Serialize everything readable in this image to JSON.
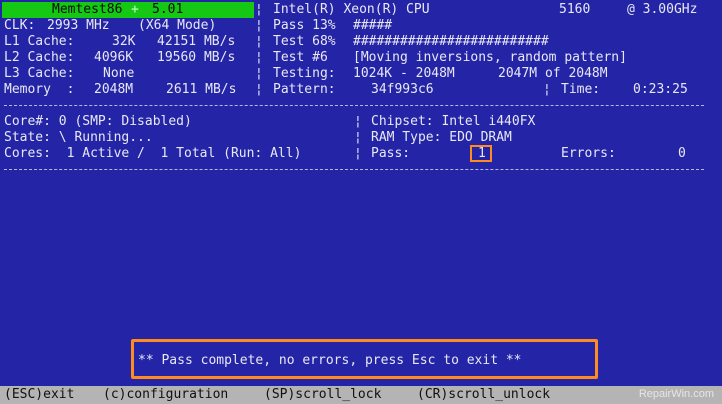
{
  "header": {
    "app_name": "Memtest86",
    "app_plus": "+",
    "version": "5.01",
    "cpu_name": "Intel(R) Xeon(R) CPU",
    "cpu_model": "5160",
    "cpu_freq": "@ 3.00GHz"
  },
  "system": {
    "clk_label": "CLK:",
    "clk_value": "2993 MHz",
    "clk_mode": "(X64 Mode)",
    "l1_label": "L1 Cache:",
    "l1_size": "32K",
    "l1_speed": "42151 MB/s",
    "l2_label": "L2 Cache:",
    "l2_size": "4096K",
    "l2_speed": "19560 MB/s",
    "l3_label": "L3 Cache:",
    "l3_size": "None",
    "mem_label": "Memory  :",
    "mem_size": "2048M",
    "mem_speed": "2611 MB/s"
  },
  "progress": {
    "pass_label": "Pass 13%",
    "pass_percent": 13,
    "pass_bar": "#####",
    "test_label": "Test 68%",
    "test_percent": 68,
    "test_bar": "#########################",
    "test_num_label": "Test #6",
    "test_desc": "[Moving inversions, random pattern]",
    "testing_label": "Testing:",
    "testing_range": "1024K - 2048M",
    "testing_of": "2047M of 2048M",
    "pattern_label": "Pattern:",
    "pattern_value": "34f993c6",
    "time_label": "Time:",
    "time_value": "0:23:25"
  },
  "status": {
    "core_line": "Core#: 0 (SMP: Disabled)",
    "state_line": "State: \\ Running...",
    "cores_line": "Cores:  1 Active /  1 Total (Run: All)",
    "chipset_line": "Chipset: Intel i440FX",
    "ram_line": "RAM Type: EDO DRAM",
    "pass_label": "Pass:",
    "pass_value": "1",
    "errors_label": "Errors:",
    "errors_value": "0"
  },
  "message": "** Pass complete, no errors, press Esc to exit **",
  "footer": {
    "esc": "(ESC)exit",
    "config": "(c)configuration",
    "scroll_lock": "(SP)scroll_lock",
    "scroll_unlock": "(CR)scroll_unlock"
  },
  "watermark": "RepairWin.com",
  "colors": {
    "background": "#2424a6",
    "title_green": "#14c814",
    "highlight_orange": "#ff8a1e",
    "footer_gray": "#b4b4b4"
  }
}
